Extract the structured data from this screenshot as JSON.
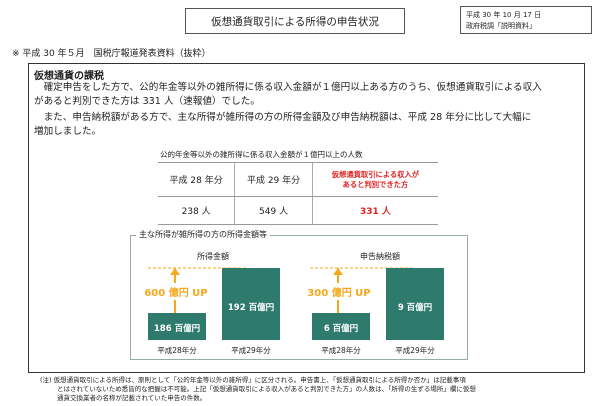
{
  "header": {
    "title": "仮想通貨取引による所得の申告状況",
    "date": "平成 30 年 10 月 17 日",
    "source": "政府税調「説明資料」"
  },
  "note": "※ 平成 30 年５月　国税庁報道発表資料（抜粋）",
  "section": {
    "heading": "仮想通貨の課税",
    "para1_line1": "　確定申告をした方で、公的年金等以外の雑所得に係る収入金額が１億円以上ある方のうち、仮想通貨取引による収入",
    "para1_line2": "があると判別できた方は 331 人（速報値）でした。",
    "para2_line1": "　また、申告納税額がある方で、主な所得が雑所得の方の所得金額及び申告納税額は、平成 28 年分に比して大幅に",
    "para2_line2": "増加しました。"
  },
  "table": {
    "caption": "公的年金等以外の雑所得に係る収入金額が１億円以上の人数",
    "headers": [
      "平成 28 年分",
      "平成 29 年分",
      "仮想通貨取引による収入が",
      "あると判別できた方"
    ],
    "values": [
      "238 人",
      "549 人",
      "331 人"
    ]
  },
  "charts": {
    "title": "主な所得が雑所得の方の所得金額等",
    "left": {
      "label": "所得金額",
      "bar1_label": "186 百億円",
      "bar2_label": "192 百億円",
      "increase_label": "600 億円 UP",
      "x1": "平成28年分",
      "x2": "平成29年分"
    },
    "right": {
      "label": "申告納税額",
      "bar1_label": "6 百億円",
      "bar2_label": "9 百億円",
      "increase_label": "300 億円 UP",
      "x1": "平成28年分",
      "x2": "平成29年分"
    }
  },
  "colors": {
    "bar": "#2e7b6e",
    "increase": "#f4a81d",
    "highlight": "#e02020"
  },
  "footnote": {
    "line1": "(注)  仮想通貨取引による所得は、原則として「公的年金等以外の雑所得」に区分される。申告書上、「仮想通貨取引による所得か否か」は記載事項",
    "line2": "とはされていないため悉皆的な把握は不可能。上記「仮想通貨取引による収入があると判別できた方」の人数は、「所得の生ずる場所」欄に仮想",
    "line3": "通貨交換業者の名称が記載されていた申告の件数。"
  }
}
